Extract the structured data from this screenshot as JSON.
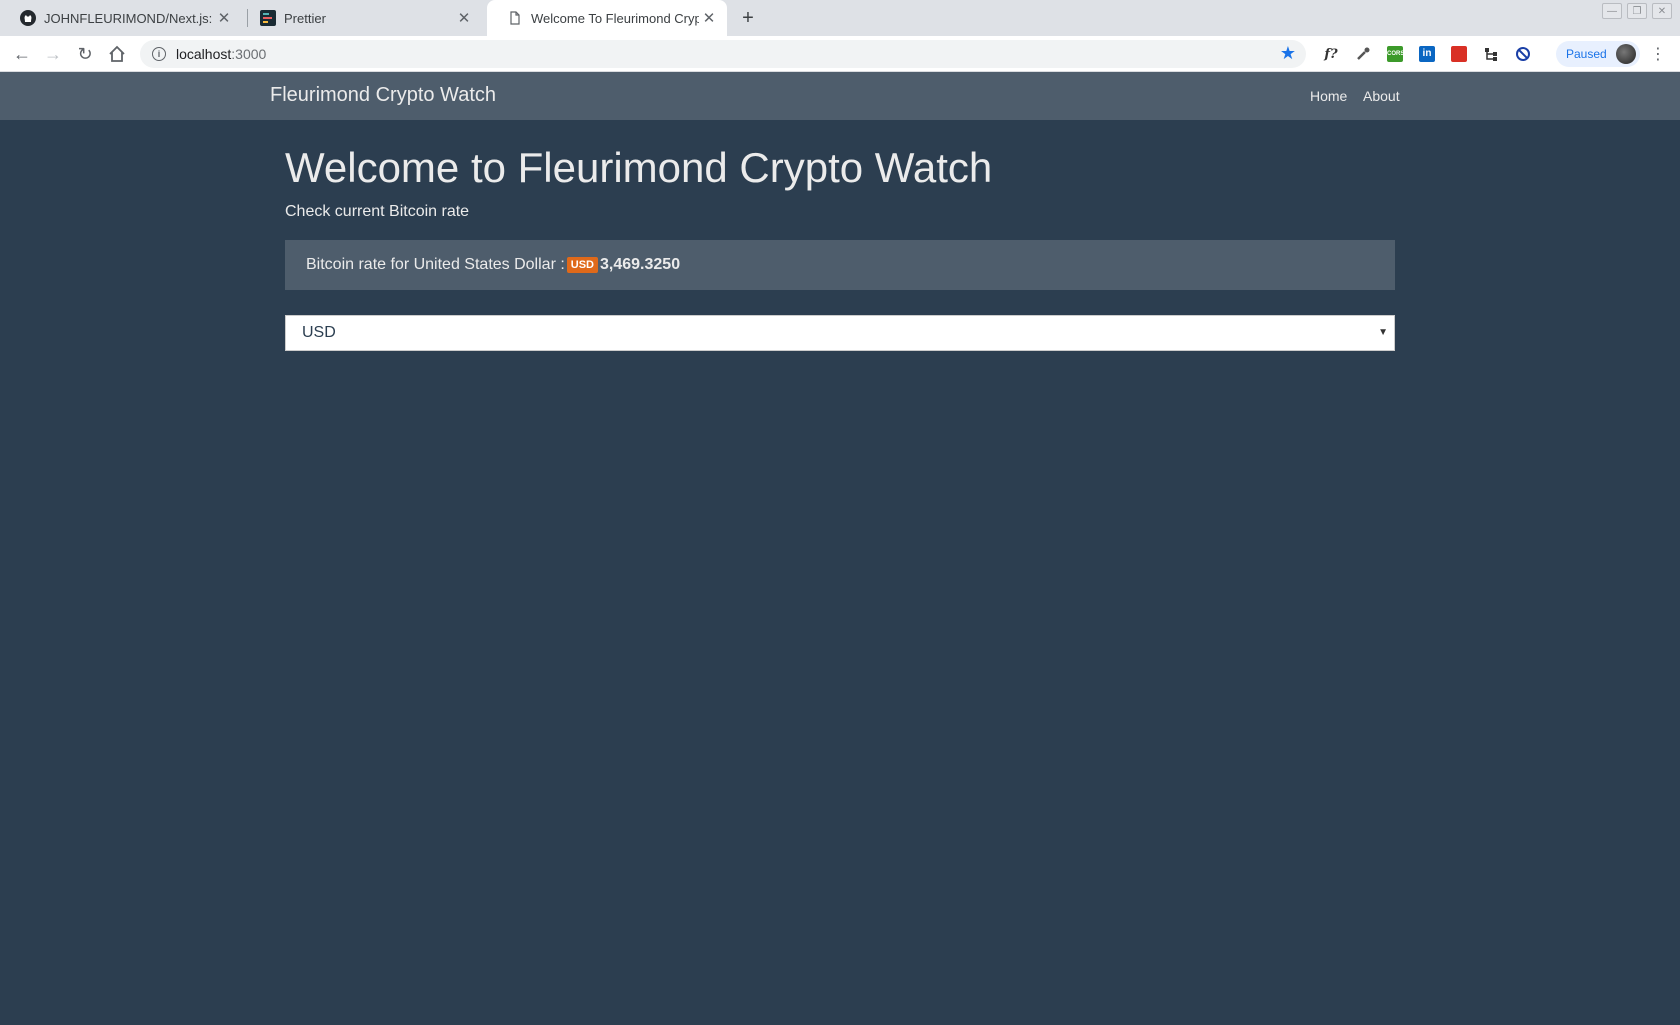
{
  "browser": {
    "tabs": [
      {
        "title": "JOHNFLEURIMOND/Next.js: Ne",
        "icon": "github-icon",
        "active": false
      },
      {
        "title": "Prettier",
        "icon": "prettier-icon",
        "active": false
      },
      {
        "title": "Welcome To Fleurimond Crypto",
        "icon": "page-icon",
        "active": true
      }
    ],
    "address": {
      "host": "localhost",
      "port": ":3000"
    },
    "profile_status": "Paused",
    "extensions": [
      "font-finder-icon",
      "eyedropper-icon",
      "cors-icon",
      "linkedin-icon",
      "chrome-reader-icon",
      "tree-icon",
      "block-icon"
    ]
  },
  "site": {
    "brand": "Fleurimond Crypto Watch",
    "nav": {
      "home": "Home",
      "about": "About"
    }
  },
  "main": {
    "title": "Welcome to Fleurimond Crypto Watch",
    "subtitle": "Check current Bitcoin rate",
    "rate": {
      "label": "Bitcoin rate for United States Dollar :",
      "badge": "USD",
      "value": "3,469.3250"
    },
    "select": {
      "selected": "USD"
    }
  },
  "colors": {
    "background": "#2c3e50",
    "navbar": "#4e5d6c",
    "badge": "#df691a",
    "text": "#ebebeb"
  }
}
